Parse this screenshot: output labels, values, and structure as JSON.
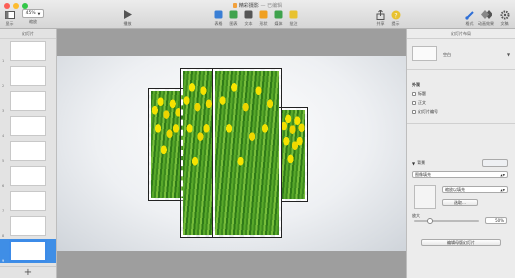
{
  "window": {
    "title": "精彩摄影",
    "subtitle": "— 已编辑",
    "traffic_colors": [
      "#fc5f57",
      "#fdbc2e",
      "#33c748"
    ]
  },
  "toolbar": {
    "display_label": "显示",
    "zoom_value": "45%",
    "zoom_label": "缩放",
    "play_label": "播放",
    "insert_items": [
      {
        "label": "表格",
        "icon": "table-icon",
        "color": "#3a7fd5"
      },
      {
        "label": "图表",
        "icon": "chart-icon",
        "color": "#3fa34d"
      },
      {
        "label": "文本",
        "icon": "text-icon",
        "color": "#555555"
      },
      {
        "label": "形状",
        "icon": "shape-icon",
        "color": "#f0a020"
      },
      {
        "label": "媒体",
        "icon": "media-icon",
        "color": "#3fa34d"
      },
      {
        "label": "批注",
        "icon": "comment-icon",
        "color": "#e8c230"
      }
    ],
    "share_label": "共享",
    "tips_label": "提示",
    "format_label": "格式",
    "animate_label": "动画效果",
    "document_label": "文稿"
  },
  "navigator": {
    "header": "幻灯片",
    "slides": [
      {
        "num": "1"
      },
      {
        "num": "2"
      },
      {
        "num": "3"
      },
      {
        "num": "4"
      },
      {
        "num": "5"
      },
      {
        "num": "6"
      },
      {
        "num": "7"
      },
      {
        "num": "8"
      },
      {
        "num": "9"
      }
    ],
    "selected": 9,
    "add_label": "+"
  },
  "inspector": {
    "header": "幻灯片布局",
    "layout_name": "空白",
    "appearance_label": "外观",
    "appearance_options": [
      {
        "label": "标题",
        "checked": false
      },
      {
        "label": "正文",
        "checked": false
      },
      {
        "label": "幻灯片编号",
        "checked": false
      }
    ],
    "background_label": "背景",
    "fill_type": "图像填充",
    "fill_mode": "缩放以填充",
    "choose_button": "选取…",
    "scale_label": "放大",
    "scale_value": "50%",
    "edit_master_button": "编辑母版幻灯片"
  }
}
